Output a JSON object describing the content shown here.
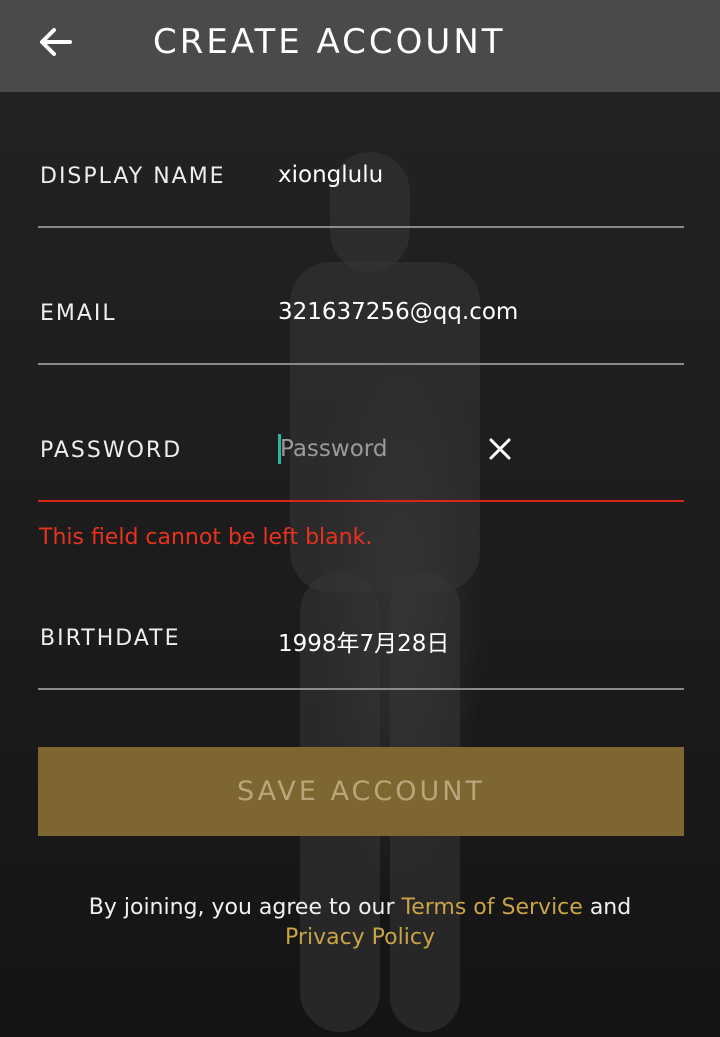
{
  "header": {
    "title": "CREATE ACCOUNT",
    "back_icon": "arrow-left-icon"
  },
  "form": {
    "display_name": {
      "label": "DISPLAY NAME",
      "value": "xionglulu"
    },
    "email": {
      "label": "EMAIL",
      "value": "321637256@qq.com"
    },
    "password": {
      "label": "PASSWORD",
      "value": "",
      "placeholder": "Password",
      "clear_icon": "close-icon"
    },
    "error": "This field cannot be left blank.",
    "birthdate": {
      "label": "BIRTHDATE",
      "value": "1998年7月28日"
    }
  },
  "actions": {
    "save_label": "SAVE ACCOUNT"
  },
  "legal": {
    "prefix": "By joining, you agree to our",
    "terms": "Terms of Service",
    "conjunction": "and",
    "privacy": "Privacy Policy"
  },
  "colors": {
    "accent": "#c9a347",
    "error": "#d8261b",
    "button_bg": "#7e6633",
    "caret": "#27b3a6"
  }
}
